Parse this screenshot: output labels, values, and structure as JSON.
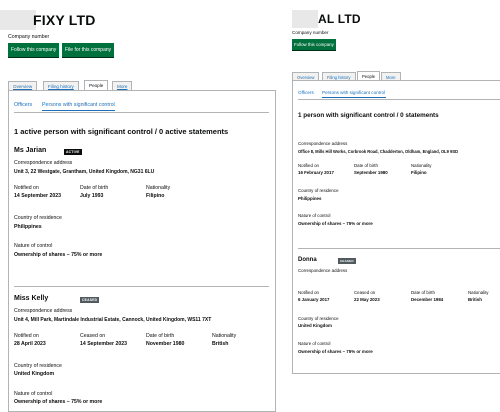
{
  "left": {
    "company_title": "FIXY LTD",
    "company_number_label": "Company number",
    "follow_button": "Follow this company",
    "file_button": "File for this company",
    "tabs": [
      "Overview",
      "Filing history",
      "People",
      "More"
    ],
    "subtabs": [
      "Officers",
      "Persons with significant control"
    ],
    "heading": "1 active person with significant control / 0 active statements",
    "persons": [
      {
        "name": "Ms Jarian",
        "badge": "ACTIVE",
        "correspondence_label": "Correspondence address",
        "address": "Unit 3, 22 Westgate, Grantham, United Kingdom, NG31 6LU",
        "notified_label": "Notified on",
        "notified_value": "14 September 2023",
        "dob_label": "Date of birth",
        "dob_value": "July 1993",
        "nationality_label": "Nationality",
        "nationality_value": "Filipino",
        "residence_label": "Country of residence",
        "residence_value": "Philippines",
        "control_label": "Nature of control",
        "control_value": "Ownership of shares – 75% or more"
      },
      {
        "name": "Miss Kelly",
        "badge": "CEASED",
        "correspondence_label": "Correspondence address",
        "address": "Unit 4, Mill Park, Martindale Industrial Estate, Cannock, United Kingdom, WS11 7XT",
        "notified_label": "Notified on",
        "notified_value": "28 April 2023",
        "ceased_label": "Ceased on",
        "ceased_value": "14 September 2023",
        "dob_label": "Date of birth",
        "dob_value": "November 1980",
        "nationality_label": "Nationality",
        "nationality_value": "British",
        "residence_label": "Country of residence",
        "residence_value": "United Kingdom",
        "control_label": "Nature of control",
        "control_value": "Ownership of shares – 75% or more"
      }
    ]
  },
  "right": {
    "company_title": "AL LTD",
    "company_number_label": "Company number",
    "follow_button": "Follow this company",
    "tabs": [
      "Overview",
      "Filing history",
      "People",
      "More"
    ],
    "subtabs": [
      "Officers",
      "Persons with significant control"
    ],
    "heading": "1 person with significant control / 0 statements",
    "persons": [
      {
        "correspondence_label": "Correspondence address",
        "address": "Office 8, Mills Hill Works, Corbrook Road, Chadderton, Oldham, England, OL9 9SD",
        "notified_label": "Notified on",
        "notified_value": "16 February 2017",
        "dob_label": "Date of birth",
        "dob_value": "September 1980",
        "nationality_label": "Nationality",
        "nationality_value": "Filipino",
        "residence_label": "Country of residence",
        "residence_value": "Philippines",
        "control_label": "Nature of control",
        "control_value": "Ownership of shares – 75% or more"
      },
      {
        "name": "Donna",
        "badge": "CEASED",
        "correspondence_label": "Correspondence address",
        "notified_label": "Notified on",
        "notified_value": "6 January 2017",
        "ceased_label": "Ceased on",
        "ceased_value": "22 May 2023",
        "dob_label": "Date of birth",
        "dob_value": "December 1984",
        "nationality_label": "Nationality",
        "nationality_value": "British",
        "residence_label": "Country of residence",
        "residence_value": "United Kingdom",
        "control_label": "Nature of control",
        "control_value": "Ownership of shares – 75% or more"
      }
    ]
  }
}
